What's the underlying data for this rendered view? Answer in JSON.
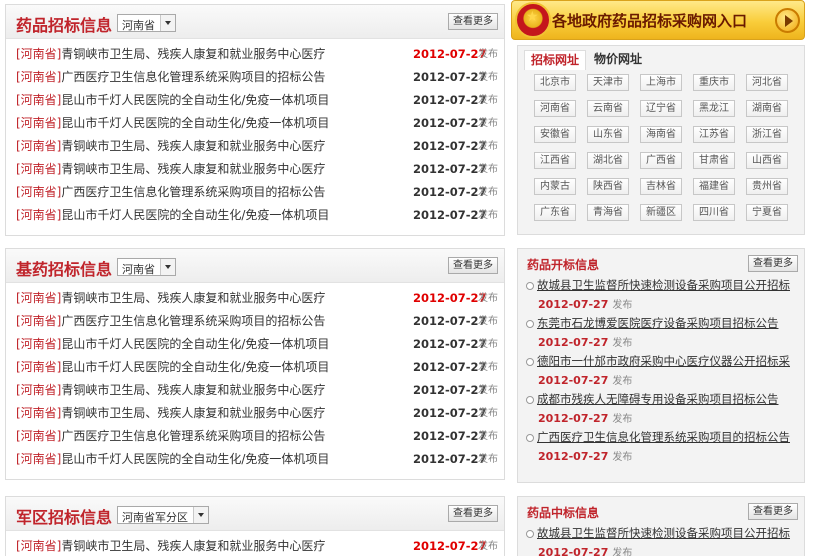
{
  "panels": [
    {
      "title": "药品招标信息",
      "region_select": "河南省",
      "more": "查看更多",
      "items": [
        {
          "region": "[河南省]",
          "text": "青铜峡市卫生局、残疾人康复和就业服务中心医疗",
          "date": "2012-07-27",
          "hot": true,
          "pub": "发布"
        },
        {
          "region": "[河南省]",
          "text": "广西医疗卫生信息化管理系统采购项目的招标公告",
          "date": "2012-07-27",
          "hot": false,
          "pub": "发布"
        },
        {
          "region": "[河南省]",
          "text": "昆山市千灯人民医院的全自动生化/免疫一体机项目",
          "date": "2012-07-27",
          "hot": false,
          "pub": "发布"
        },
        {
          "region": "[河南省]",
          "text": "昆山市千灯人民医院的全自动生化/免疫一体机项目",
          "date": "2012-07-27",
          "hot": false,
          "pub": "发布"
        },
        {
          "region": "[河南省]",
          "text": "青铜峡市卫生局、残疾人康复和就业服务中心医疗",
          "date": "2012-07-27",
          "hot": false,
          "pub": "发布"
        },
        {
          "region": "[河南省]",
          "text": "青铜峡市卫生局、残疾人康复和就业服务中心医疗",
          "date": "2012-07-27",
          "hot": false,
          "pub": "发布"
        },
        {
          "region": "[河南省]",
          "text": "广西医疗卫生信息化管理系统采购项目的招标公告",
          "date": "2012-07-27",
          "hot": false,
          "pub": "发布"
        },
        {
          "region": "[河南省]",
          "text": "昆山市千灯人民医院的全自动生化/免疫一体机项目",
          "date": "2012-07-27",
          "hot": false,
          "pub": "发布"
        }
      ]
    },
    {
      "title": "基药招标信息",
      "region_select": "河南省",
      "more": "查看更多",
      "items": [
        {
          "region": "[河南省]",
          "text": "青铜峡市卫生局、残疾人康复和就业服务中心医疗",
          "date": "2012-07-27",
          "hot": true,
          "pub": "发布"
        },
        {
          "region": "[河南省]",
          "text": "广西医疗卫生信息化管理系统采购项目的招标公告",
          "date": "2012-07-27",
          "hot": false,
          "pub": "发布"
        },
        {
          "region": "[河南省]",
          "text": "昆山市千灯人民医院的全自动生化/免疫一体机项目",
          "date": "2012-07-27",
          "hot": false,
          "pub": "发布"
        },
        {
          "region": "[河南省]",
          "text": "昆山市千灯人民医院的全自动生化/免疫一体机项目",
          "date": "2012-07-27",
          "hot": false,
          "pub": "发布"
        },
        {
          "region": "[河南省]",
          "text": "青铜峡市卫生局、残疾人康复和就业服务中心医疗",
          "date": "2012-07-27",
          "hot": false,
          "pub": "发布"
        },
        {
          "region": "[河南省]",
          "text": "青铜峡市卫生局、残疾人康复和就业服务中心医疗",
          "date": "2012-07-27",
          "hot": false,
          "pub": "发布"
        },
        {
          "region": "[河南省]",
          "text": "广西医疗卫生信息化管理系统采购项目的招标公告",
          "date": "2012-07-27",
          "hot": false,
          "pub": "发布"
        },
        {
          "region": "[河南省]",
          "text": "昆山市千灯人民医院的全自动生化/免疫一体机项目",
          "date": "2012-07-27",
          "hot": false,
          "pub": "发布"
        }
      ]
    },
    {
      "title": "军区招标信息",
      "region_select": "河南省军分区",
      "more": "查看更多",
      "items": [
        {
          "region": "[河南省]",
          "text": "青铜峡市卫生局、残疾人康复和就业服务中心医疗",
          "date": "2012-07-27",
          "hot": true,
          "pub": "发布"
        }
      ]
    }
  ],
  "banner": {
    "text": "各地政府药品招标采购网入口"
  },
  "url_panel": {
    "tabs": [
      "招标网址",
      "物价网址"
    ],
    "provinces": [
      "北京市",
      "天津市",
      "上海市",
      "重庆市",
      "河北省",
      "河南省",
      "云南省",
      "辽宁省",
      "黑龙江",
      "湖南省",
      "安徽省",
      "山东省",
      "海南省",
      "江苏省",
      "浙江省",
      "江西省",
      "湖北省",
      "广西省",
      "甘肃省",
      "山西省",
      "内蒙古",
      "陕西省",
      "吉林省",
      "福建省",
      "贵州省",
      "广东省",
      "青海省",
      "新疆区",
      "四川省",
      "宁夏省"
    ]
  },
  "side_panels": [
    {
      "title": "药品开标信息",
      "more": "查看更多",
      "items": [
        {
          "text": "故城县卫生监督所快速检测设备采购项目公开招标",
          "date": "2012-07-27",
          "pub": "发布"
        },
        {
          "text": "东莞市石龙博爱医院医疗设备采购项目招标公告",
          "date": "2012-07-27",
          "pub": "发布"
        },
        {
          "text": "德阳市一什邡市政府采购中心医疗仪器公开招标采",
          "date": "2012-07-27",
          "pub": "发布"
        },
        {
          "text": "成都市残疾人无障碍专用设备采购项目招标公告",
          "date": "2012-07-27",
          "pub": "发布"
        },
        {
          "text": "广西医疗卫生信息化管理系统采购项目的招标公告",
          "date": "2012-07-27",
          "pub": "发布"
        }
      ]
    },
    {
      "title": "药品中标信息",
      "more": "查看更多",
      "items": [
        {
          "text": "故城县卫生监督所快速检测设备采购项目公开招标",
          "date": "2012-07-27",
          "pub": "发布"
        }
      ]
    }
  ]
}
